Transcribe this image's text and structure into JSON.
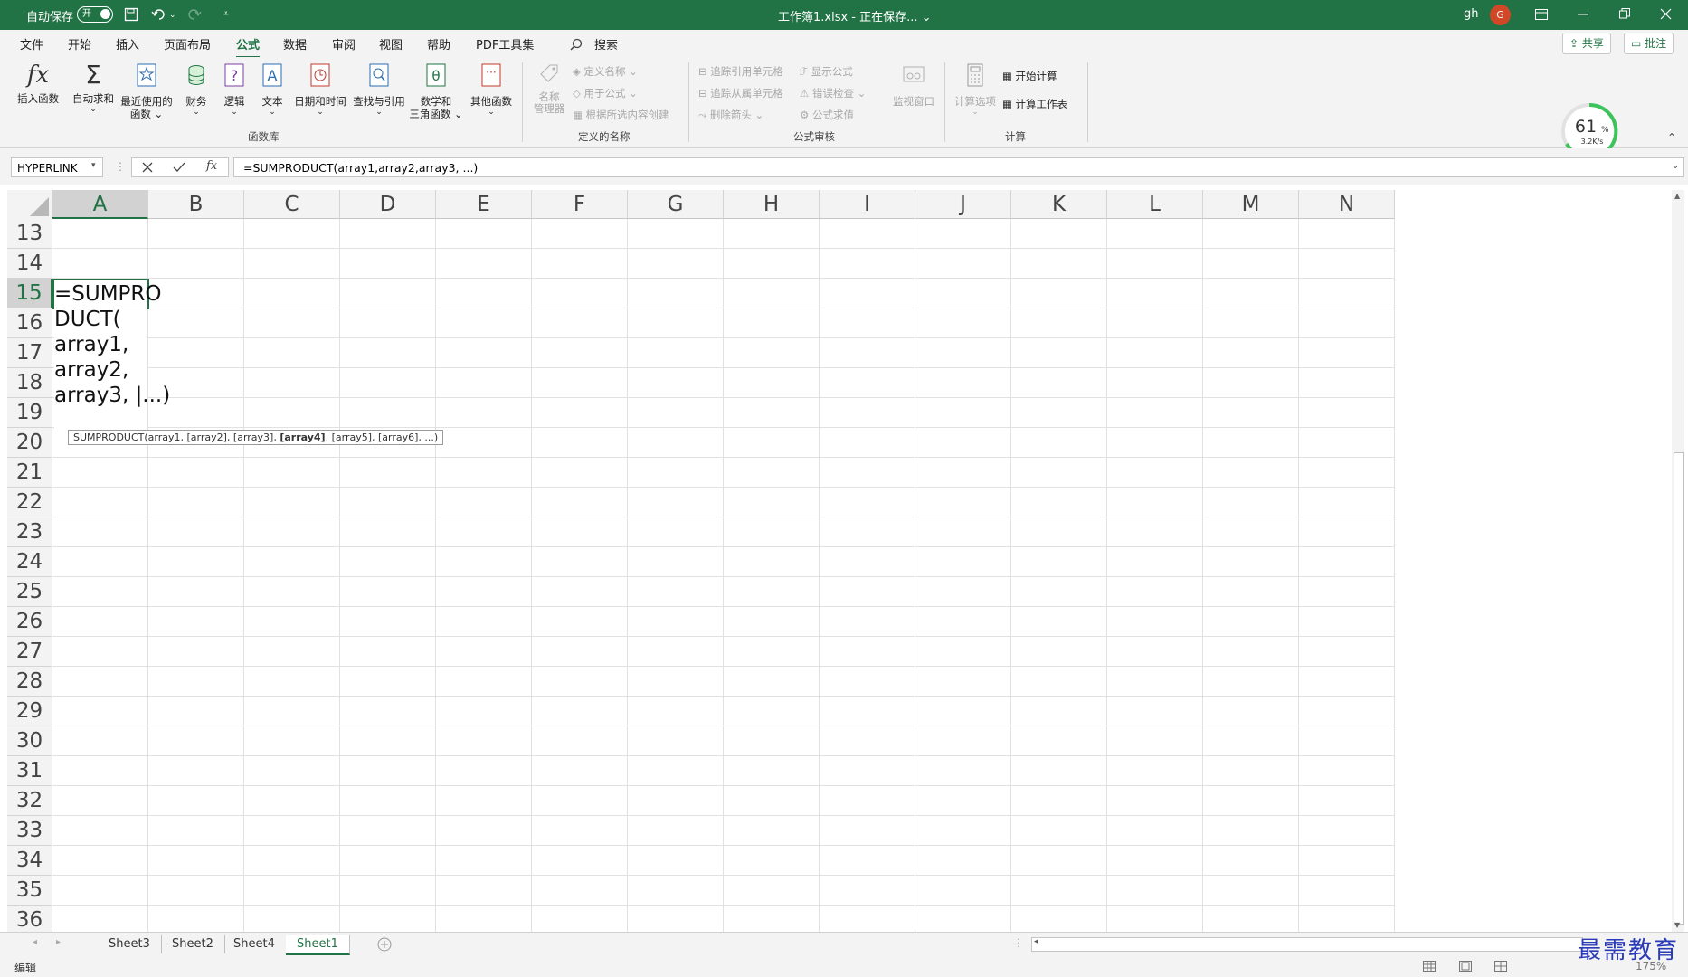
{
  "titlebar": {
    "autosave_label": "自动保存",
    "autosave_state": "开",
    "title": "工作簿1.xlsx - 正在保存... ⌄",
    "user": "gh",
    "avatar_letter": "G"
  },
  "tabs": [
    "文件",
    "开始",
    "插入",
    "页面布局",
    "公式",
    "数据",
    "审阅",
    "视图",
    "帮助",
    "PDF工具集"
  ],
  "active_tab": "公式",
  "search_label": "搜索",
  "share_label": "共享",
  "comment_label": "批注",
  "ribbon": {
    "insert_function": "插入函数",
    "autosum": "自动求和",
    "recent_1": "最近使用的",
    "recent_2": "函数",
    "finance": "财务",
    "logic": "逻辑",
    "text": "文本",
    "datetime": "日期和时间",
    "lookup": "查找与引用",
    "math_1": "数学和",
    "math_2": "三角函数",
    "other": "其他函数",
    "group_library": "函数库",
    "name_mgr_1": "名称",
    "name_mgr_2": "管理器",
    "define_name": "定义名称",
    "use_in_formula": "用于公式",
    "create_from_sel": "根据所选内容创建",
    "group_names": "定义的名称",
    "trace_precedents": "追踪引用单元格",
    "trace_dependents": "追踪从属单元格",
    "remove_arrows": "删除箭头",
    "show_formulas": "显示公式",
    "error_check": "错误检查",
    "evaluate": "公式求值",
    "watch_window": "监视窗口",
    "group_audit": "公式审核",
    "calc_options": "计算选项",
    "calc_now": "开始计算",
    "calc_sheet": "计算工作表",
    "group_calc": "计算"
  },
  "gauge": {
    "percent": "61",
    "unit": "%",
    "speed": "3.2K/s"
  },
  "formula_bar": {
    "name_box": "HYPERLINK",
    "formula": "=SUMPRODUCT(array1,array2,array3, ...)"
  },
  "columns": [
    "A",
    "B",
    "C",
    "D",
    "E",
    "F",
    "G",
    "H",
    "I",
    "J",
    "K",
    "L",
    "M",
    "N"
  ],
  "rows": [
    "13",
    "14",
    "15",
    "16",
    "17",
    "18",
    "19",
    "20",
    "21",
    "22",
    "23",
    "24",
    "25",
    "26",
    "27",
    "28",
    "29",
    "30",
    "31",
    "32",
    "33",
    "34",
    "35",
    "36"
  ],
  "cell_lines": [
    "=SUMPRO",
    "DUCT(",
    "array1,",
    "array2,",
    "array3, |...)"
  ],
  "tooltip": {
    "pre": "SUMPRODUCT(array1, [array2], [array3], ",
    "bold": "[array4]",
    "post": ", [array5], [array6], ...)"
  },
  "sheets": [
    "Sheet3",
    "Sheet2",
    "Sheet4",
    "Sheet1"
  ],
  "active_sheet": "Sheet1",
  "status": {
    "mode": "编辑",
    "zoom": "175%"
  },
  "watermark": "最需教育"
}
